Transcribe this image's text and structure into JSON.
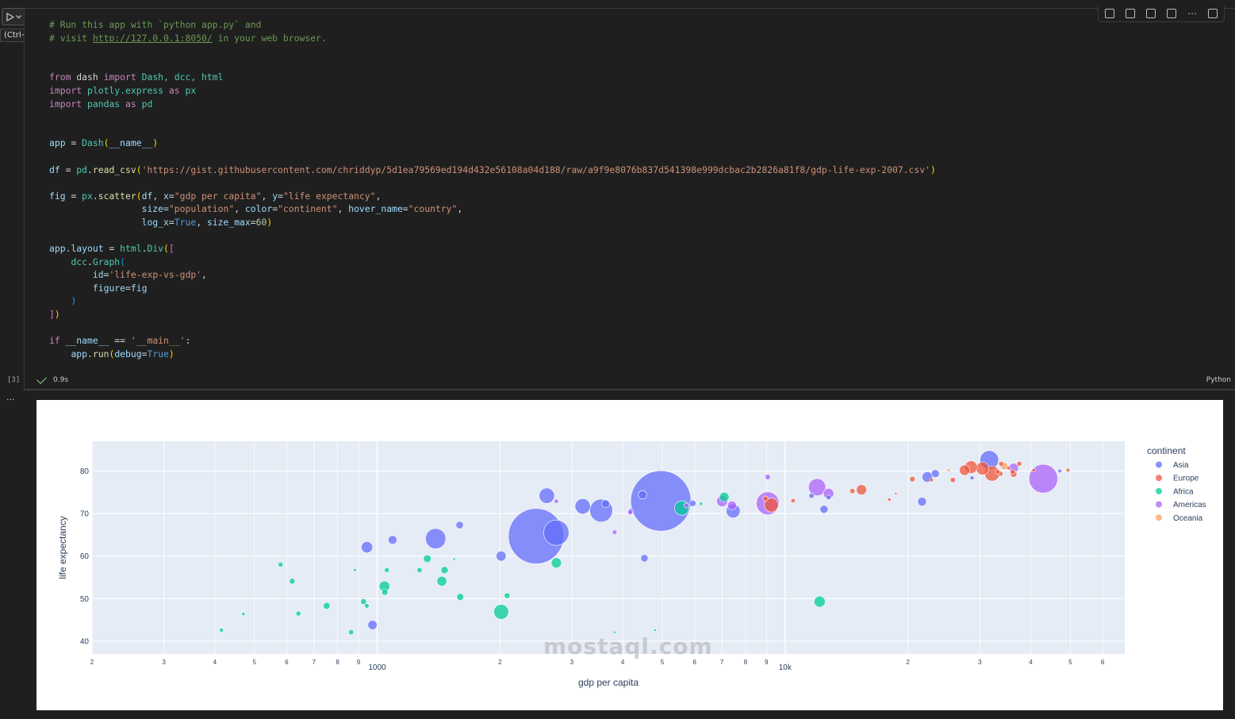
{
  "run_tooltip": "(Ctrl+Alt+Enter)",
  "code_lines": [
    [
      [
        "# Run this app with `python app.py` and",
        "cm"
      ]
    ],
    [
      [
        "# visit ",
        "cm"
      ],
      [
        "http://127.0.0.1:8050/",
        "cm-u"
      ],
      [
        " in your web browser.",
        "cm"
      ]
    ],
    [],
    [],
    [
      [
        "from",
        "kw"
      ],
      [
        " dash ",
        ""
      ],
      [
        "import",
        "kw"
      ],
      [
        " Dash, dcc, html",
        "cls"
      ]
    ],
    [
      [
        "import",
        "kw"
      ],
      [
        " plotly.express ",
        "cls"
      ],
      [
        "as",
        "kw"
      ],
      [
        " px",
        "cls"
      ]
    ],
    [
      [
        "import",
        "kw"
      ],
      [
        " pandas ",
        "cls"
      ],
      [
        "as",
        "kw"
      ],
      [
        " pd",
        "cls"
      ]
    ],
    [],
    [],
    [
      [
        "app",
        "vr"
      ],
      [
        " = ",
        ""
      ],
      [
        "Dash",
        "cls"
      ],
      [
        "(",
        "br1"
      ],
      [
        "__name__",
        "vr"
      ],
      [
        ")",
        "br1"
      ]
    ],
    [],
    [
      [
        "df",
        "vr"
      ],
      [
        " = ",
        ""
      ],
      [
        "pd",
        "cls"
      ],
      [
        ".",
        ""
      ],
      [
        "read_csv",
        "fn"
      ],
      [
        "(",
        "br1"
      ],
      [
        "'https://gist.githubusercontent.com/chriddyp/5d1ea79569ed194d432e56108a04d188/raw/a9f9e8076b837d541398e999dcbac2b2826a81f8/gdp-life-exp-2007.csv'",
        "st"
      ],
      [
        ")",
        "br1"
      ]
    ],
    [],
    [
      [
        "fig",
        "vr"
      ],
      [
        " = ",
        ""
      ],
      [
        "px",
        "cls"
      ],
      [
        ".",
        ""
      ],
      [
        "scatter",
        "fn"
      ],
      [
        "(",
        "br1"
      ],
      [
        "df",
        "vr"
      ],
      [
        ", ",
        ""
      ],
      [
        "x",
        "vr"
      ],
      [
        "=",
        ""
      ],
      [
        "\"gdp per capita\"",
        "st"
      ],
      [
        ", ",
        ""
      ],
      [
        "y",
        "vr"
      ],
      [
        "=",
        ""
      ],
      [
        "\"life expectancy\"",
        "st"
      ],
      [
        ",",
        ""
      ]
    ],
    [
      [
        "                 ",
        ""
      ],
      [
        "size",
        "vr"
      ],
      [
        "=",
        ""
      ],
      [
        "\"population\"",
        "st"
      ],
      [
        ", ",
        ""
      ],
      [
        "color",
        "vr"
      ],
      [
        "=",
        ""
      ],
      [
        "\"continent\"",
        "st"
      ],
      [
        ", ",
        ""
      ],
      [
        "hover_name",
        "vr"
      ],
      [
        "=",
        ""
      ],
      [
        "\"country\"",
        "st"
      ],
      [
        ",",
        ""
      ]
    ],
    [
      [
        "                 ",
        ""
      ],
      [
        "log_x",
        "vr"
      ],
      [
        "=",
        ""
      ],
      [
        "True",
        "bl"
      ],
      [
        ", ",
        ""
      ],
      [
        "size_max",
        "vr"
      ],
      [
        "=",
        ""
      ],
      [
        "60",
        "nm"
      ],
      [
        ")",
        "br1"
      ]
    ],
    [],
    [
      [
        "app",
        "vr"
      ],
      [
        ".",
        ""
      ],
      [
        "layout",
        "vr"
      ],
      [
        " = ",
        ""
      ],
      [
        "html",
        "cls"
      ],
      [
        ".",
        ""
      ],
      [
        "Div",
        "cls"
      ],
      [
        "(",
        "br1"
      ],
      [
        "[",
        "br2"
      ]
    ],
    [
      [
        "    ",
        ""
      ],
      [
        "dcc",
        "cls"
      ],
      [
        ".",
        ""
      ],
      [
        "Graph",
        "cls"
      ],
      [
        "(",
        "br3"
      ]
    ],
    [
      [
        "        ",
        ""
      ],
      [
        "id",
        "vr"
      ],
      [
        "=",
        ""
      ],
      [
        "'life-exp-vs-gdp'",
        "st"
      ],
      [
        ",",
        ""
      ]
    ],
    [
      [
        "        ",
        ""
      ],
      [
        "figure",
        "vr"
      ],
      [
        "=",
        ""
      ],
      [
        "fig",
        "vr"
      ]
    ],
    [
      [
        "    ",
        ""
      ],
      [
        ")",
        "br3"
      ]
    ],
    [
      [
        "]",
        "br2"
      ],
      [
        ")",
        "br1"
      ]
    ],
    [],
    [
      [
        "if",
        "kw"
      ],
      [
        " ",
        ""
      ],
      [
        "__name__",
        "vr"
      ],
      [
        " == ",
        ""
      ],
      [
        "'__main__'",
        "st"
      ],
      [
        ":",
        ""
      ]
    ],
    [
      [
        "    ",
        ""
      ],
      [
        "app",
        "vr"
      ],
      [
        ".",
        ""
      ],
      [
        "run",
        "fn"
      ],
      [
        "(",
        "br1"
      ],
      [
        "debug",
        "vr"
      ],
      [
        "=",
        ""
      ],
      [
        "True",
        "bl"
      ],
      [
        ")",
        "br1"
      ]
    ]
  ],
  "exec_count": "[3]",
  "exec_time": "0.9s",
  "language": "Python",
  "output_dots": "...",
  "watermark": "mostaql.com",
  "colors": {
    "Asia": "#636efa",
    "Europe": "#ef553b",
    "Africa": "#00cc96",
    "Americas": "#ab63fa",
    "Oceania": "#ffa15a",
    "plot_bg": "#e5ecf6"
  },
  "chart_data": {
    "type": "scatter",
    "title": "",
    "xlabel": "gdp per capita",
    "ylabel": "life expectancy",
    "x_scale": "log",
    "xlim": [
      200,
      68000
    ],
    "ylim": [
      37,
      87
    ],
    "x_ticks": [
      {
        "v": 200,
        "label": "2"
      },
      {
        "v": 300,
        "label": "3"
      },
      {
        "v": 400,
        "label": "4"
      },
      {
        "v": 500,
        "label": "5"
      },
      {
        "v": 600,
        "label": "6"
      },
      {
        "v": 700,
        "label": "7"
      },
      {
        "v": 800,
        "label": "8"
      },
      {
        "v": 900,
        "label": "9"
      },
      {
        "v": 1000,
        "label": "1000"
      },
      {
        "v": 2000,
        "label": "2"
      },
      {
        "v": 3000,
        "label": "3"
      },
      {
        "v": 4000,
        "label": "4"
      },
      {
        "v": 5000,
        "label": "5"
      },
      {
        "v": 6000,
        "label": "6"
      },
      {
        "v": 7000,
        "label": "7"
      },
      {
        "v": 8000,
        "label": "8"
      },
      {
        "v": 9000,
        "label": "9"
      },
      {
        "v": 10000,
        "label": "10k"
      },
      {
        "v": 20000,
        "label": "2"
      },
      {
        "v": 30000,
        "label": "3"
      },
      {
        "v": 40000,
        "label": "4"
      },
      {
        "v": 50000,
        "label": "5"
      },
      {
        "v": 60000,
        "label": "6"
      }
    ],
    "y_ticks": [
      40,
      50,
      60,
      70,
      80
    ],
    "legend_title": "continent",
    "legend_position": "right",
    "grid": true,
    "series": [
      {
        "name": "Asia",
        "points": [
          [
            4959,
            72.96,
            1319
          ],
          [
            2452,
            64.7,
            1110
          ],
          [
            2749,
            65.5,
            233
          ],
          [
            31656,
            82.6,
            127
          ],
          [
            3541,
            70.7,
            190
          ],
          [
            1391,
            64.1,
            150
          ],
          [
            2605,
            74.2,
            86
          ],
          [
            3190,
            71.7,
            85
          ],
          [
            944,
            62.1,
            47
          ],
          [
            1091,
            63.8,
            28
          ],
          [
            2013,
            60.0,
            36
          ],
          [
            1593,
            67.3,
            20
          ],
          [
            5937,
            72.4,
            15
          ],
          [
            3632,
            72.3,
            23
          ],
          [
            4471,
            74.4,
            26
          ],
          [
            4185,
            70.6,
            10
          ],
          [
            7458,
            70.6,
            70
          ],
          [
            22316,
            78.6,
            40
          ],
          [
            23348,
            79.4,
            23
          ],
          [
            12452,
            71.0,
            24
          ],
          [
            11606,
            74.2,
            10
          ],
          [
            12779,
            73.8,
            8
          ],
          [
            47143,
            80.0,
            5
          ],
          [
            28718,
            78.4,
            6
          ],
          [
            21655,
            72.8,
            28
          ],
          [
            4520,
            59.5,
            20
          ],
          [
            974,
            43.8,
            31
          ]
        ]
      },
      {
        "name": "Europe",
        "points": [
          [
            36126,
            79.8,
            8
          ],
          [
            33692,
            79.4,
            10
          ],
          [
            30470,
            80.6,
            61
          ],
          [
            32170,
            79.4,
            82
          ],
          [
            28569,
            80.9,
            58
          ],
          [
            36319,
            79.3,
            16
          ],
          [
            27538,
            80.2,
            40
          ],
          [
            33860,
            81.7,
            9
          ],
          [
            18008,
            73.3,
            4
          ],
          [
            9254,
            72.0,
            71
          ],
          [
            8948,
            73.5,
            10
          ],
          [
            10461,
            73.0,
            7
          ],
          [
            15390,
            75.6,
            38
          ],
          [
            22833,
            77.9,
            5
          ],
          [
            20510,
            78.1,
            11
          ],
          [
            35278,
            80.7,
            5
          ],
          [
            40676,
            80.2,
            4
          ],
          [
            49357,
            80.2,
            5
          ],
          [
            37506,
            81.7,
            9
          ],
          [
            33207,
            79.8,
            8
          ],
          [
            18679,
            74.7,
            2
          ],
          [
            25768,
            77.9,
            10
          ],
          [
            14619,
            75.3,
            10
          ]
        ]
      },
      {
        "name": "Africa",
        "points": [
          [
            2014,
            46.9,
            80
          ],
          [
            1042,
            52.9,
            41
          ],
          [
            1463,
            56.7,
            19
          ],
          [
            641,
            46.5,
            9
          ],
          [
            1598,
            50.4,
            18
          ],
          [
            2082,
            50.7,
            12
          ],
          [
            4797,
            42.6,
            1.8
          ],
          [
            12154,
            49.3,
            45
          ],
          [
            3821,
            42.1,
            1.1
          ],
          [
            1270,
            56.7,
            10
          ],
          [
            5581,
            71.3,
            76
          ],
          [
            2749,
            58.4,
            38
          ],
          [
            1327,
            59.4,
            22
          ],
          [
            1044,
            51.5,
            14
          ],
          [
            863,
            42.1,
            10
          ],
          [
            943,
            48.3,
            8
          ],
          [
            1056,
            56.7,
            9
          ],
          [
            1441,
            54.1,
            35
          ],
          [
            752,
            48.3,
            17
          ],
          [
            619,
            54.1,
            12
          ],
          [
            580,
            58.0,
            9
          ],
          [
            1545,
            59.3,
            2
          ],
          [
            415,
            42.6,
            6
          ],
          [
            470,
            46.4,
            4
          ],
          [
            7093,
            73.9,
            33
          ],
          [
            6223,
            72.3,
            4
          ],
          [
            926,
            49.3,
            13
          ],
          [
            882,
            56.7,
            3.2
          ]
        ]
      },
      {
        "name": "Americas",
        "points": [
          [
            42952,
            78.2,
            301
          ],
          [
            9066,
            72.4,
            190
          ],
          [
            11978,
            76.2,
            108
          ],
          [
            36319,
            80.7,
            33
          ],
          [
            12779,
            74.7,
            40
          ],
          [
            7007,
            72.9,
            44
          ],
          [
            9065,
            78.6,
            11
          ],
          [
            7408,
            71.9,
            29
          ],
          [
            5728,
            71.9,
            9
          ],
          [
            3820,
            65.6,
            8
          ],
          [
            2749,
            72.9,
            7
          ],
          [
            4172,
            70.3,
            9
          ]
        ]
      },
      {
        "name": "Oceania",
        "points": [
          [
            34435,
            81.2,
            20
          ],
          [
            25185,
            80.2,
            4
          ]
        ]
      }
    ]
  }
}
